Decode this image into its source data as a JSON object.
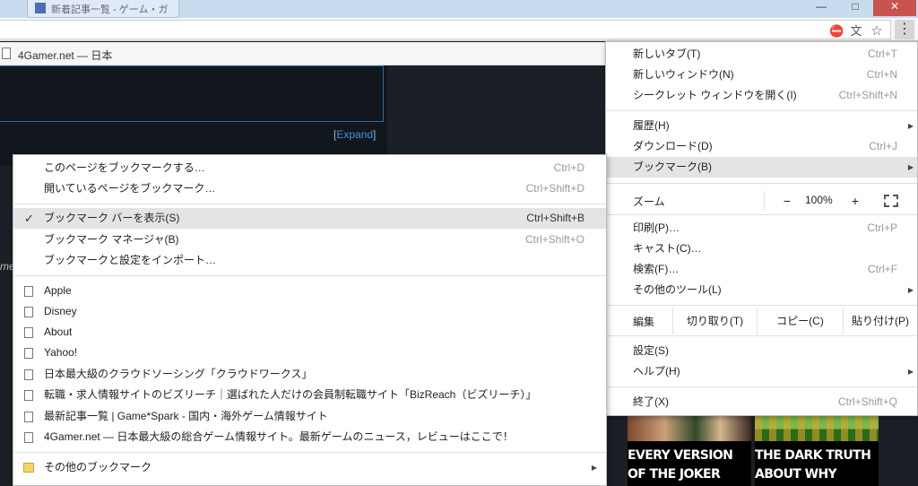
{
  "browser": {
    "tab_title": "新着記事一覧 - ゲーム・ガ",
    "window_controls": {
      "minimize": "—",
      "maximize": "□",
      "close": "✕"
    }
  },
  "page": {
    "title": "4Gamer.net — 日本",
    "expand": {
      "open": "[",
      "link": "Expand",
      "close": "]"
    },
    "fragment": "me",
    "cards": [
      {
        "title": "EVERY VERSION OF THE JOKER RANKED FROM"
      },
      {
        "title": "THE DARK TRUTH ABOUT WHY YOSHI STICKS OUT"
      }
    ]
  },
  "chrome_menu": {
    "new_tab": {
      "label": "新しいタブ(T)",
      "shortcut": "Ctrl+T"
    },
    "new_window": {
      "label": "新しいウィンドウ(N)",
      "shortcut": "Ctrl+N"
    },
    "incognito": {
      "label": "シークレット ウィンドウを開く(I)",
      "shortcut": "Ctrl+Shift+N"
    },
    "history": {
      "label": "履歴(H)"
    },
    "downloads": {
      "label": "ダウンロード(D)",
      "shortcut": "Ctrl+J"
    },
    "bookmarks": {
      "label": "ブックマーク(B)"
    },
    "zoom": {
      "label": "ズーム",
      "minus": "−",
      "value": "100%",
      "plus": "+"
    },
    "print": {
      "label": "印刷(P)…",
      "shortcut": "Ctrl+P"
    },
    "cast": {
      "label": "キャスト(C)…"
    },
    "find": {
      "label": "検索(F)…",
      "shortcut": "Ctrl+F"
    },
    "more_tools": {
      "label": "その他のツール(L)"
    },
    "edit": {
      "label": "編集",
      "cut": "切り取り(T)",
      "copy": "コピー(C)",
      "paste": "貼り付け(P)"
    },
    "settings": {
      "label": "設定(S)"
    },
    "help": {
      "label": "ヘルプ(H)"
    },
    "exit": {
      "label": "終了(X)",
      "shortcut": "Ctrl+Shift+Q"
    }
  },
  "bookmark_menu": {
    "bookmark_page": {
      "label": "このページをブックマークする…",
      "shortcut": "Ctrl+D"
    },
    "bookmark_open": {
      "label": "開いているページをブックマーク…",
      "shortcut": "Ctrl+Shift+D"
    },
    "show_bar": {
      "label": "ブックマーク バーを表示(S)",
      "shortcut": "Ctrl+Shift+B",
      "checked": true
    },
    "manager": {
      "label": "ブックマーク マネージャ(B)",
      "shortcut": "Ctrl+Shift+O"
    },
    "import": {
      "label": "ブックマークと設定をインポート…"
    },
    "bookmarks": [
      "Apple",
      "Disney",
      "About",
      "Yahoo!",
      "日本最大級のクラウドソーシング「クラウドワークス」",
      "転職・求人情報サイトのビズリーチ｜選ばれた人だけの会員制転職サイト「BizReach（ビズリーチ）」",
      "最新記事一覧 | Game*Spark - 国内・海外ゲーム情報サイト",
      "4Gamer.net ― 日本最大級の総合ゲーム情報サイト。最新ゲームのニュース，レビューはここで！"
    ],
    "other": {
      "label": "その他のブックマーク"
    }
  },
  "icons": {
    "check": "✓",
    "submenu_arrow": "▶",
    "menu": "⋮",
    "star": "☆",
    "block": "⛔",
    "translate": "文"
  }
}
